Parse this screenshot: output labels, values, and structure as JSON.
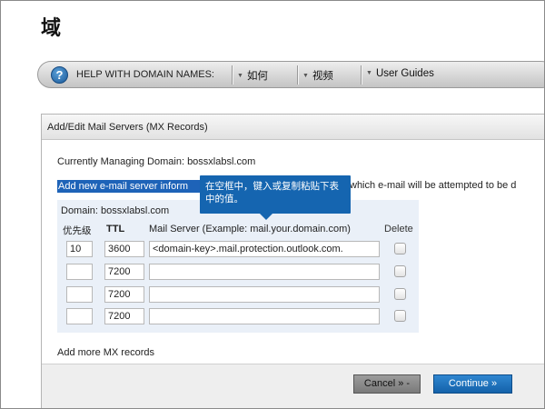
{
  "page": {
    "title": "域"
  },
  "help_bar": {
    "label": "HELP WITH DOMAIN NAMES:",
    "links": [
      "如何",
      "视频",
      "User Guides"
    ]
  },
  "panel": {
    "title": "Add/Edit Mail Servers (MX Records)",
    "managing_prefix": "Currently Managing Domain: bossxlabsl.com",
    "add_highlight": "Add new e-mail server inform",
    "add_rest": "which e-mail will be attempted to be d",
    "tooltip": "在空框中，键入或复制粘贴下表中的值。",
    "domain_label": "Domain: bossxlabsl.com",
    "columns": {
      "priority": "优先级",
      "ttl": "TTL",
      "server": "Mail Server (Example: mail.your.domain.com)",
      "delete": "Delete"
    },
    "rows": [
      {
        "priority": "10",
        "ttl": "3600",
        "server": "<domain-key>.mail.protection.outlook.com."
      },
      {
        "priority": "",
        "ttl": "7200",
        "server": ""
      },
      {
        "priority": "",
        "ttl": "7200",
        "server": ""
      },
      {
        "priority": "",
        "ttl": "7200",
        "server": ""
      }
    ],
    "add_more": "Add more MX records",
    "cancel_label": "Cancel » -",
    "continue_label": "Continue »"
  }
}
